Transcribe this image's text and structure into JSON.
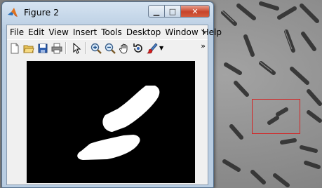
{
  "window": {
    "title": "Figure 2",
    "minimize_glyph": "▁",
    "maximize_glyph": "□",
    "close_glyph": "✕"
  },
  "menu": {
    "items": [
      "File",
      "Edit",
      "View",
      "Insert",
      "Tools",
      "Desktop",
      "Window",
      "Help"
    ],
    "overflow_glyph": "↘"
  },
  "toolbar": {
    "buttons": [
      "new-figure",
      "open-file",
      "save",
      "print",
      "edit-plot-arrow",
      "zoom-in",
      "zoom-out",
      "pan",
      "rotate-3d",
      "data-brush"
    ],
    "overflow_glyph": "»"
  },
  "colors": {
    "roi_border": "#d42424",
    "mask_background": "#000000",
    "mask_foreground": "#ffffff"
  }
}
